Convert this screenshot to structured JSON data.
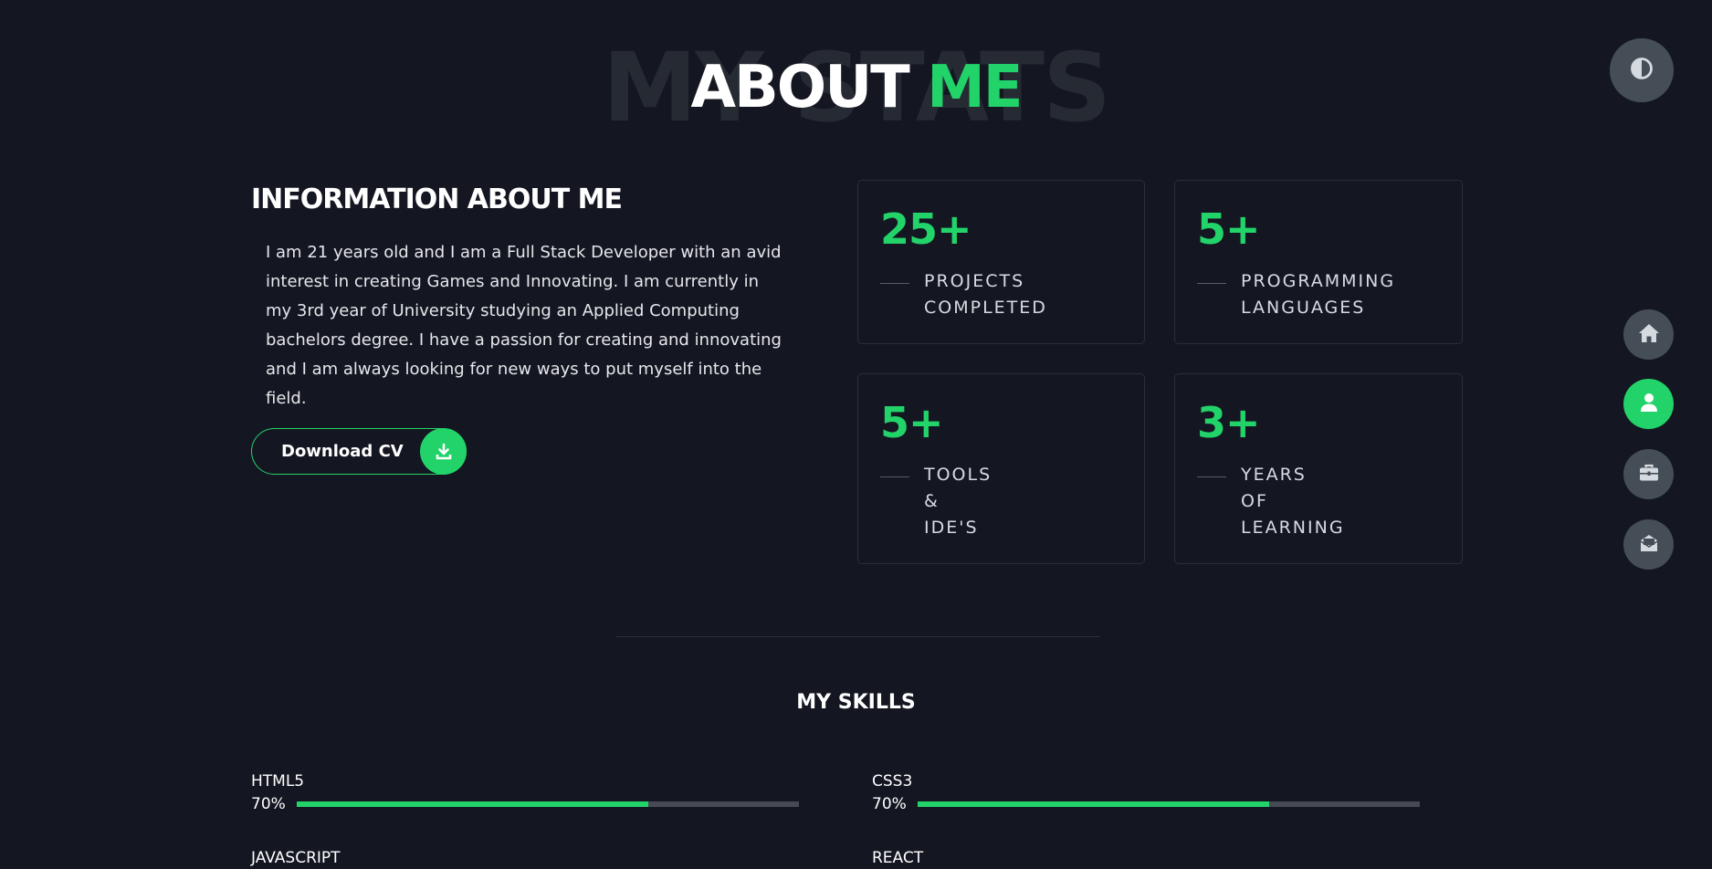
{
  "title": {
    "background_text": "MY STATS",
    "main": "ABOUT",
    "accent": "ME"
  },
  "info": {
    "heading": "INFORMATION ABOUT ME",
    "text": "I am 21 years old and I am a Full Stack Developer with an avid interest in creating Games and Innovating. I am currently in my 3rd year of University studying an Applied Computing bachelors degree. I have a passion for creating and innovating and I am always looking for new ways to put myself into the field.",
    "cv_button_label": "Download CV",
    "cv_icon": "download-icon"
  },
  "stats": [
    {
      "number": "25+",
      "label_lines": [
        "PROJECTS",
        "COMPLETED"
      ]
    },
    {
      "number": "5+",
      "label_lines": [
        "PROGRAMMING",
        "LANGUAGES"
      ]
    },
    {
      "number": "5+",
      "label_lines": [
        "TOOLS",
        "&",
        "IDE'S"
      ]
    },
    {
      "number": "3+",
      "label_lines": [
        "YEARS",
        "OF",
        "LEARNING"
      ]
    }
  ],
  "skills": {
    "title": "MY SKILLS",
    "items": [
      {
        "name": "HTML5",
        "percent_label": "70%",
        "percent": 70
      },
      {
        "name": "CSS3",
        "percent_label": "70%",
        "percent": 70
      },
      {
        "name": "JAVASCRIPT",
        "percent_label": "",
        "percent": null
      },
      {
        "name": "REACT",
        "percent_label": "",
        "percent": null
      }
    ]
  },
  "controls": {
    "theme_icon": "contrast-icon",
    "nav": [
      {
        "icon": "home-icon",
        "active": false
      },
      {
        "icon": "user-icon",
        "active": true
      },
      {
        "icon": "briefcase-icon",
        "active": false
      },
      {
        "icon": "mail-icon",
        "active": false
      }
    ]
  },
  "colors": {
    "background": "#141722",
    "accent": "#22d369",
    "card_border": "#2a2e38",
    "control_bg": "#454e56"
  }
}
